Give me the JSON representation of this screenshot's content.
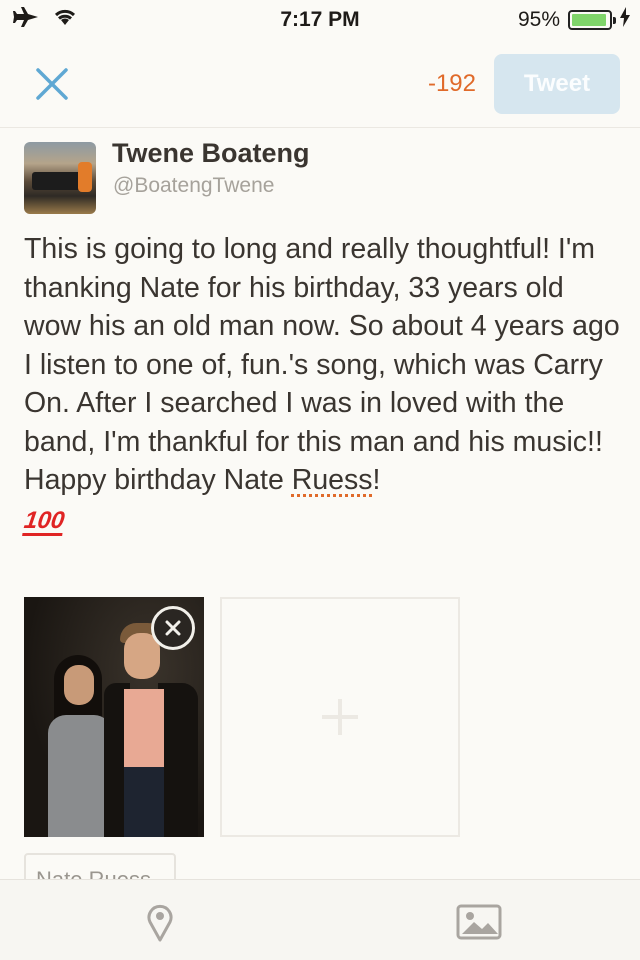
{
  "status_bar": {
    "time": "7:17 PM",
    "battery_percent": "95%",
    "battery_level": 0.95,
    "icons": [
      "airplane-icon",
      "wifi-icon",
      "battery-icon",
      "charging-icon"
    ]
  },
  "header": {
    "close_icon": "close-icon",
    "char_count": "-192",
    "tweet_label": "Tweet"
  },
  "profile": {
    "display_name": "Twene Boateng",
    "handle": "@BoatengTwene"
  },
  "tweet": {
    "text_before": "This is going to long and really thoughtful! I'm thanking Nate for his birthday, 33 years old wow his an old man now. So about 4 years ago I listen to one of, fun.'s song, which was Carry On. After I searched I was in loved with the band, I'm thankful for this man and his music!! Happy birthday Nate ",
    "misspelled_word": "Ruess",
    "text_after": "!",
    "emoji": "💯",
    "emoji_glyph": "100"
  },
  "attachments": {
    "remove_icon": "close-circle-icon",
    "add_icon": "plus-icon"
  },
  "tag_label": "Nate Ruess",
  "toolbar": {
    "location_icon": "location-pin-icon",
    "media_icon": "image-icon"
  },
  "colors": {
    "accent_orange": "#e06a2a",
    "close_blue": "#5fa8d3",
    "tweet_button_disabled": "#d6e6ef",
    "background": "#fbfaf6"
  }
}
